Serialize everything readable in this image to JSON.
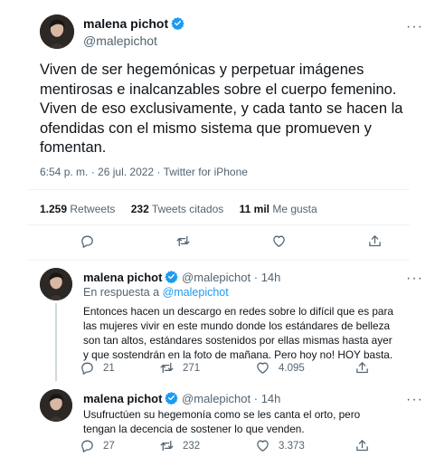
{
  "colors": {
    "accent": "#1d9bf0",
    "muted": "#536471",
    "text": "#0f1419",
    "border": "#eff3f4"
  },
  "main_tweet": {
    "author_name": "malena pichot",
    "handle": "@malepichot",
    "verified_icon": "verified-badge-icon",
    "text": "Viven de ser hegemónicas y perpetuar imágenes mentirosas e inalcanzables sobre el cuerpo femenino. Viven de eso exclusivamente, y cada tanto se hacen la ofendidas con el mismo sistema que promueven y fomentan.",
    "time": "6:54 p. m.",
    "date": "26 jul. 2022",
    "client": "Twitter for iPhone",
    "separator": " · ",
    "stats": {
      "retweets_count": "1.259",
      "retweets_label": "Retweets",
      "quotes_count": "232",
      "quotes_label": "Tweets citados",
      "likes_count": "11 mil",
      "likes_label": "Me gusta"
    }
  },
  "replies": [
    {
      "author_name": "malena pichot",
      "handle": "@malepichot",
      "age": "· 14h",
      "reply_to_prefix": "En respuesta a",
      "reply_to_handle": "@malepichot",
      "text": "Entonces hacen un descargo en redes sobre lo difícil que es para las mujeres vivir en este mundo donde los estándares de belleza son tan altos, estándares sostenidos por ellas mismas hasta ayer y que sostendrán en la foto de mañana. Pero hoy no! HOY basta.",
      "replies_count": "21",
      "retweets_count": "271",
      "likes_count": "4.095"
    },
    {
      "author_name": "malena pichot",
      "handle": "@malepichot",
      "age": "· 14h",
      "text": "Usufructúen su hegemonía como se les canta el orto, pero tengan la decencia de sostener lo que venden.",
      "replies_count": "27",
      "retweets_count": "232",
      "likes_count": "3.373"
    }
  ]
}
